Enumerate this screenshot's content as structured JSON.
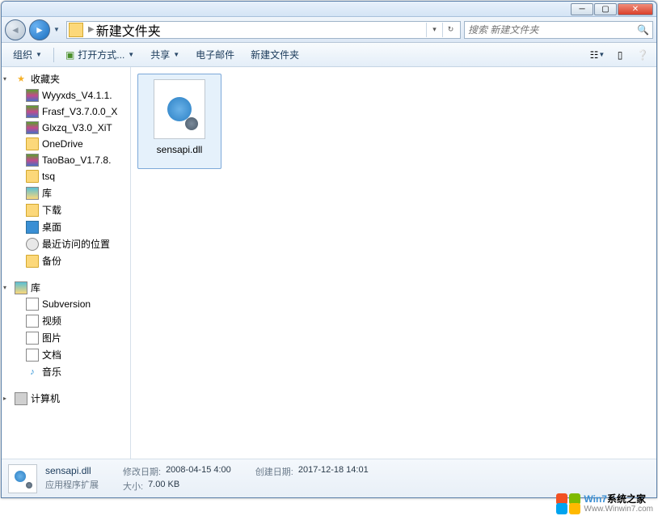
{
  "titlebar": {},
  "nav": {
    "path_segment": "新建文件夹",
    "separator": "▶"
  },
  "search": {
    "placeholder": "搜索 新建文件夹"
  },
  "toolbar": {
    "organize": "组织",
    "open_with": "打开方式...",
    "share": "共享",
    "email": "电子邮件",
    "new_folder": "新建文件夹"
  },
  "sidebar": {
    "favorites": {
      "label": "收藏夹",
      "items": [
        {
          "label": "Wyyxds_V4.1.1.",
          "icon": "rar"
        },
        {
          "label": "Frasf_V3.7.0.0_X",
          "icon": "rar"
        },
        {
          "label": "Glxzq_V3.0_XiT",
          "icon": "rar"
        },
        {
          "label": "OneDrive",
          "icon": "folder"
        },
        {
          "label": "TaoBao_V1.7.8.",
          "icon": "rar"
        },
        {
          "label": "tsq",
          "icon": "folder"
        },
        {
          "label": "库",
          "icon": "lib"
        },
        {
          "label": "下载",
          "icon": "folder"
        },
        {
          "label": "桌面",
          "icon": "desk"
        },
        {
          "label": "最近访问的位置",
          "icon": "clock"
        },
        {
          "label": "备份",
          "icon": "folder"
        }
      ]
    },
    "libraries": {
      "label": "库",
      "items": [
        {
          "label": "Subversion",
          "icon": "doc"
        },
        {
          "label": "视频",
          "icon": "doc"
        },
        {
          "label": "图片",
          "icon": "doc"
        },
        {
          "label": "文档",
          "icon": "doc"
        },
        {
          "label": "音乐",
          "icon": "music"
        }
      ]
    },
    "computer": {
      "label": "计算机"
    }
  },
  "content": {
    "files": [
      {
        "name": "sensapi.dll"
      }
    ]
  },
  "details": {
    "name": "sensapi.dll",
    "type": "应用程序扩展",
    "mod_label": "修改日期:",
    "mod_value": "2008-04-15 4:00",
    "size_label": "大小:",
    "size_value": "7.00 KB",
    "create_label": "创建日期:",
    "create_value": "2017-12-18 14:01"
  },
  "watermark": {
    "line1a": "Win7",
    "line1b": "系统之家",
    "line2": "Www.Winwin7.com"
  }
}
